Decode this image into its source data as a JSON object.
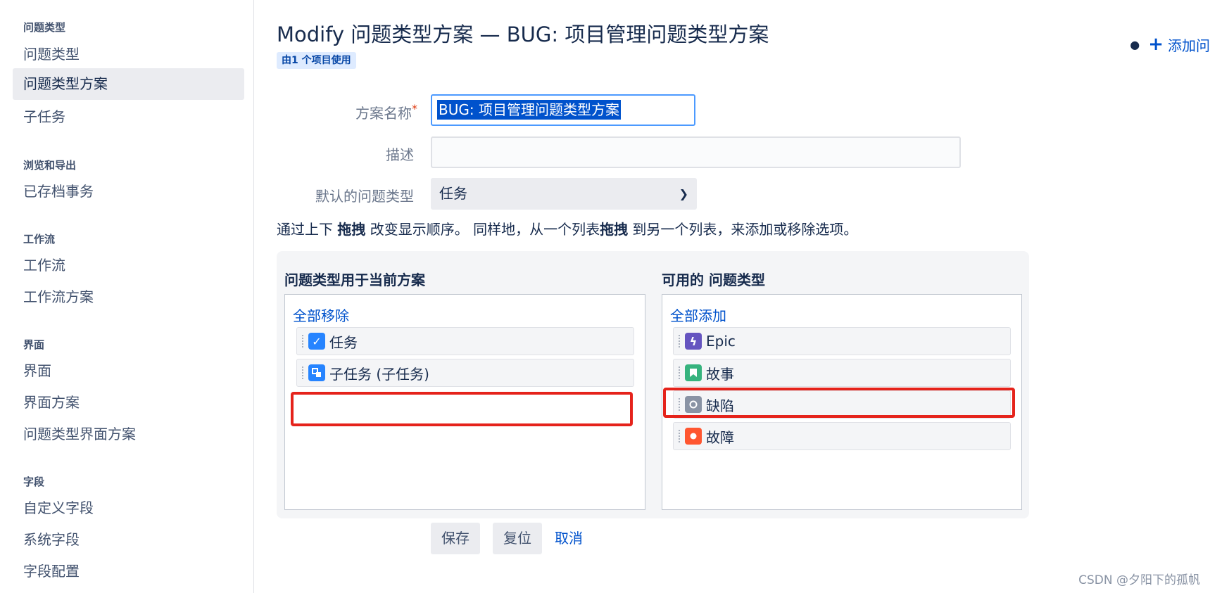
{
  "sidebar": {
    "groups": [
      {
        "heading": "问题类型",
        "items": [
          "问题类型",
          "问题类型方案",
          "子任务"
        ]
      },
      {
        "heading": "浏览和导出",
        "items": [
          "已存档事务"
        ]
      },
      {
        "heading": "工作流",
        "items": [
          "工作流",
          "工作流方案"
        ]
      },
      {
        "heading": "界面",
        "items": [
          "界面",
          "界面方案",
          "问题类型界面方案"
        ]
      },
      {
        "heading": "字段",
        "items": [
          "自定义字段",
          "系统字段",
          "字段配置"
        ]
      }
    ],
    "active_item": "问题类型方案"
  },
  "header": {
    "title": "Modify 问题类型方案 — BUG: 项目管理问题类型方案",
    "usage": "由1 个项目使用",
    "top_right_action": "添加问"
  },
  "form": {
    "name_label": "方案名称",
    "required_mark": "*",
    "name_value": "BUG: 项目管理问题类型方案",
    "desc_label": "描述",
    "desc_value": "",
    "default_type_label": "默认的问题类型",
    "default_type_value": "任务",
    "hint": {
      "part1": "通过上下 ",
      "bold1": "拖拽",
      "part2": " 改变显示顺序。 同样地，从一个列表",
      "bold2": "拖拽",
      "part3": " 到另一个列表，来添加或移除选项。"
    }
  },
  "lists": {
    "current": {
      "title": "问题类型用于当前方案",
      "action": "全部移除",
      "items": [
        {
          "label": "任务",
          "icon": "task-icon",
          "color": "#2684ff"
        },
        {
          "label": "子任务 (子任务)",
          "icon": "subtask-icon",
          "color": "#2684ff"
        }
      ]
    },
    "available": {
      "title": "可用的 问题类型",
      "action": "全部添加",
      "items": [
        {
          "label": "Epic",
          "icon": "epic-icon",
          "color": "#6554c0"
        },
        {
          "label": "故事",
          "icon": "story-icon",
          "color": "#36b37e"
        },
        {
          "label": "缺陷",
          "icon": "defect-icon",
          "color": "#8993a4"
        },
        {
          "label": "故障",
          "icon": "bug-icon",
          "color": "#ff5630"
        }
      ]
    }
  },
  "buttons": {
    "save": "保存",
    "reset": "复位",
    "cancel": "取消"
  },
  "watermark": "CSDN @夕阳下的孤帆",
  "colors": {
    "highlight": "#e5231b",
    "link": "#0052cc",
    "selection": "#0052cc"
  }
}
